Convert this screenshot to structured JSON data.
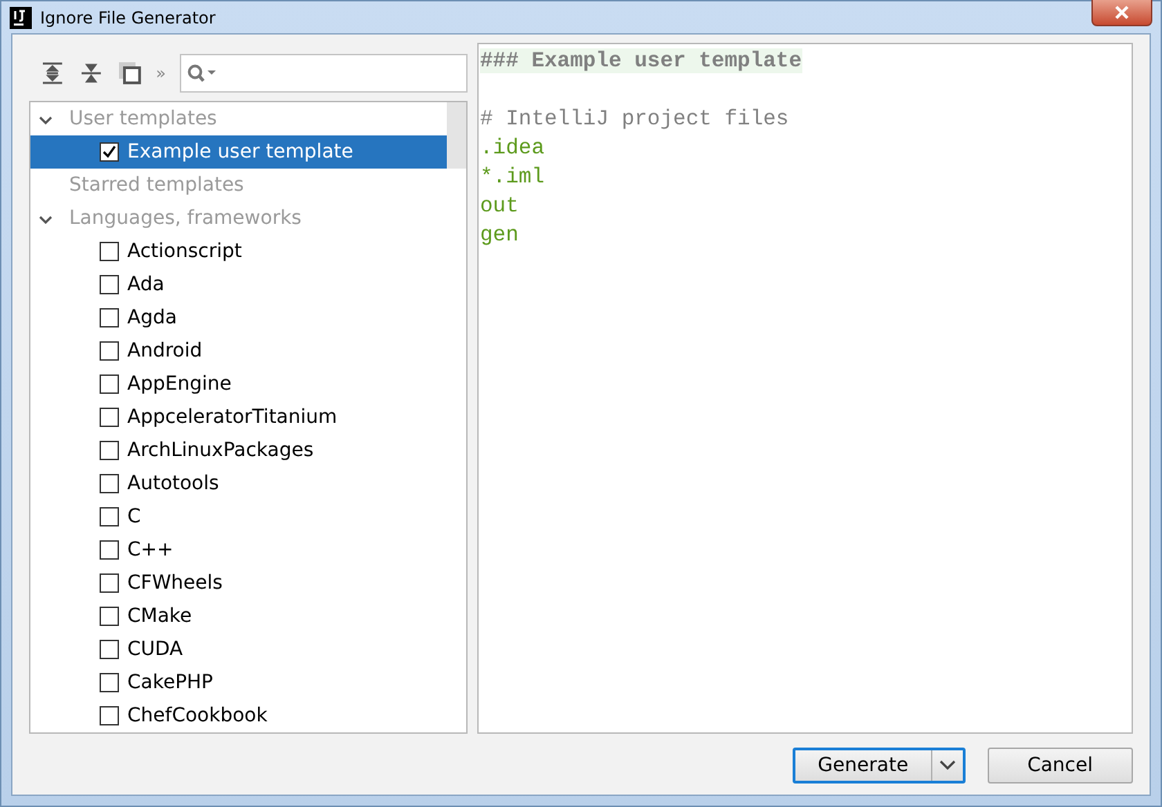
{
  "window": {
    "title": "Ignore File Generator"
  },
  "toolbar": {
    "overflow": "»"
  },
  "tree": [
    {
      "label": "User templates",
      "expanded": true,
      "children": [
        {
          "label": "Example user template",
          "checked": true,
          "selected": true
        }
      ]
    },
    {
      "label": "Starred templates",
      "expanded": false
    },
    {
      "label": "Languages, frameworks",
      "expanded": true,
      "children": [
        {
          "label": "Actionscript",
          "checked": false,
          "selected": false
        },
        {
          "label": "Ada",
          "checked": false,
          "selected": false
        },
        {
          "label": "Agda",
          "checked": false,
          "selected": false
        },
        {
          "label": "Android",
          "checked": false,
          "selected": false
        },
        {
          "label": "AppEngine",
          "checked": false,
          "selected": false
        },
        {
          "label": "AppceleratorTitanium",
          "checked": false,
          "selected": false
        },
        {
          "label": "ArchLinuxPackages",
          "checked": false,
          "selected": false
        },
        {
          "label": "Autotools",
          "checked": false,
          "selected": false
        },
        {
          "label": "C",
          "checked": false,
          "selected": false
        },
        {
          "label": "C++",
          "checked": false,
          "selected": false
        },
        {
          "label": "CFWheels",
          "checked": false,
          "selected": false
        },
        {
          "label": "CMake",
          "checked": false,
          "selected": false
        },
        {
          "label": "CUDA",
          "checked": false,
          "selected": false
        },
        {
          "label": "CakePHP",
          "checked": false,
          "selected": false
        },
        {
          "label": "ChefCookbook",
          "checked": false,
          "selected": false
        }
      ]
    }
  ],
  "editor": {
    "lines": [
      {
        "kind": "heading",
        "text": "### Example user template"
      },
      {
        "kind": "blank"
      },
      {
        "kind": "comment",
        "text": "# IntelliJ project files"
      },
      {
        "kind": "entry",
        "text": ".idea"
      },
      {
        "kind": "entry",
        "text": "*.iml"
      },
      {
        "kind": "entry",
        "text": "out"
      },
      {
        "kind": "entry",
        "text": "gen"
      }
    ]
  },
  "buttons": [
    {
      "label": "Generate",
      "kind": "split",
      "default": true
    },
    {
      "label": "Cancel",
      "kind": "plain",
      "default": false
    }
  ]
}
